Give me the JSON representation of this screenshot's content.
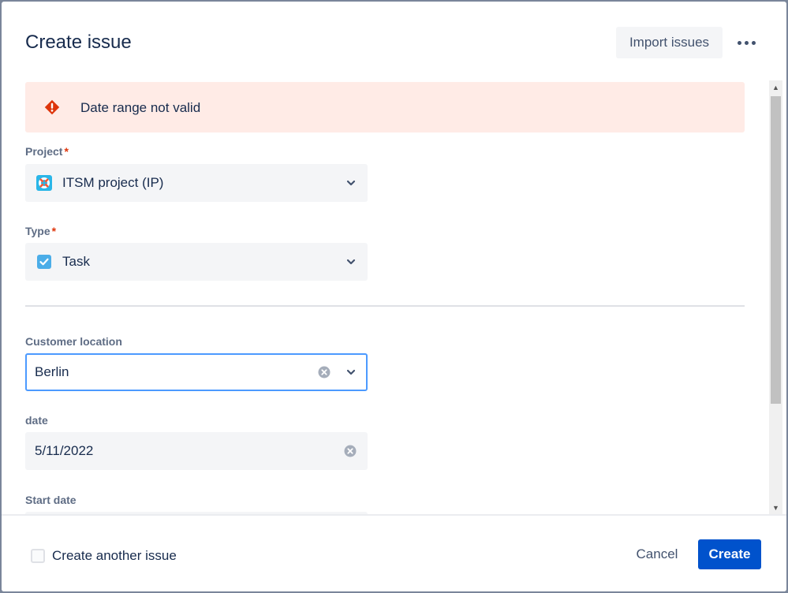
{
  "dialog": {
    "title": "Create issue",
    "import_label": "Import issues",
    "more_icon": "more-horizontal-icon"
  },
  "error": {
    "icon": "warning-icon",
    "message": "Date range not valid",
    "color": "#de350b",
    "background": "#ffebe6"
  },
  "fields": {
    "project": {
      "label": "Project",
      "required_mark": "*",
      "value": "ITSM project (IP)",
      "icon": "project-avatar-icon"
    },
    "type": {
      "label": "Type",
      "required_mark": "*",
      "value": "Task",
      "icon": "task-checkbox-icon"
    },
    "customer_location": {
      "label": "Customer location",
      "value": "Berlin"
    },
    "date": {
      "label": "date",
      "value": "5/11/2022"
    },
    "start_date": {
      "label": "Start date"
    }
  },
  "footer": {
    "create_another_label": "Create another issue",
    "create_another_checked": false,
    "cancel_label": "Cancel",
    "create_label": "Create"
  },
  "colors": {
    "primary": "#0052cc",
    "focus_border": "#4c9aff",
    "text": "#172b4d",
    "subtle_text": "#5e6c84"
  }
}
